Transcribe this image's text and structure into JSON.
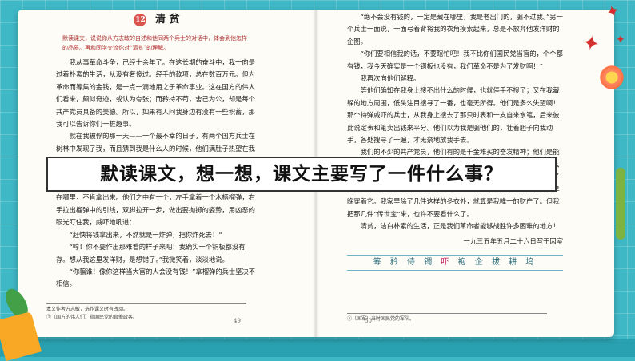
{
  "left_page": {
    "lesson_number": "12",
    "lesson_title": "清  贫",
    "guide": "默读课文，说说你从方志敏的自述和他同两个兵士的对话中，体会到他怎样的品质。再和同学交流你对“清贫”的理解。",
    "paragraphs": [
      "我从事革命斗争，已经十余年了。在这长期的奋斗中，我一向是过着朴素的生活，从没有奢侈过。经手的款项，总在数百万元。但为革命而筹集的金钱，是一点一滴地用之于革命事业。这在国方的伟人们看来，颇似奇迹，或认为夸张；而矜持不苟，舍己为公，却是每个共产党员具备的美德。所以，如果有人问我身边有没有一些积蓄，那我可以告诉你们一桩趣事。",
      "就在我被俘的那一天——一个最不幸的日子，有两个国方兵士在树林中发现了我，而且猜到我是什么人的时候，他们满肚子热望在我身上搜出一千或八百大洋，或者搜出一些金镯金戒指之类，发个意外之财。哪知道从我上身摸到下身，从袄领捏到袜底，除了一只时表和一支自来水笔之外，一个铜板都没有。他们激怒了，猜疑我是把钱藏在哪里，不肯拿出来。他们之中有一个，左手拿着一个木柄榴弹，右手拉出榴弹中的引线，双脚拉开一步，做出要抛掷的姿势，用凶恶的眼光盯住我，威吓地吼道：",
      "“赶快将钱拿出来，不然就是一炸弹，把你炸死去！”",
      "“哼！你不要作出那难看的样子来吧！我确实一个铜板都没有存。想从我这里发洋财，是想错了。”我微笑着，淡淡地说。",
      "“你骗谁！像你这样当大官的人会没有钱！”拿榴弹的兵士坚决不相信。"
    ],
    "footnote_1": "本文作者方志敏，选作课文时有改动。",
    "footnote_2": "①〔国方的伟人们〕指国民党的官僚政客。",
    "page_number": "49"
  },
  "right_page": {
    "paragraphs": [
      "“绝不会没有钱的，一定是藏在哪里，我是老出门的，骗不过我。”另一个兵士一面说，一面弓着背将我的衣角摸索起来，总是不放弃他发洋财的企图。",
      "“你们要相信我的话，不要瞎忙吧！我不比你们国民党当官的，个个都有钱，我今天确实是一个铜板也没有，我们革命不是为了发财啊！”",
      "我再次向他们解释。",
      "等他们确知在我身上搜不出什么的时候，也就停手不搜了；又在我藏躲的地方周围，低头注目搜寻了一番，也毫无所得。他们是多么失望啊！那个持弹威吓的兵士，从我身上搜去了那只时表和一支自来水笔，后来彼此说定表和笔卖出钱来平分。他们以为我是骗他们的，壮着胆子向我动手，各处搜寻了一遍，才无奈地放我手去。",
      "我们的不少的共产党员，他们有的是千金难买的奋发精神；他们是能吃苦的贫民，哪一个不是朴素的生活？只就我所知，穷人们的骨头是多么硬！我那以前的妻子在保山家里借着亲戚的一点钱，我那以前的家，除了几件“传世宝”来，也许不要看什么了。——怕国军①进来了，准备冬天早晚穿着它。我家里除了几件这样的冬衣外，就算是我唯一的财产了。但我把那几件“传世宝”来，也许不要看什么了。",
      "清贫，洁白朴素的生活，正是我们革命者能够战胜许多困难的地方！"
    ],
    "signoff": "一九三五年五月二十六日写于囚室",
    "words_prefix": "筹  矜  侍  镯  ",
    "words_highlight": "吓",
    "words_suffix": "  袍  企  拔  耕  坞",
    "footnote": "①〔国军〕当时国民党的军队。",
    "page_number": "50"
  },
  "banner": {
    "question": "默读课文，想一想，课文主要写了一件什么事？"
  }
}
